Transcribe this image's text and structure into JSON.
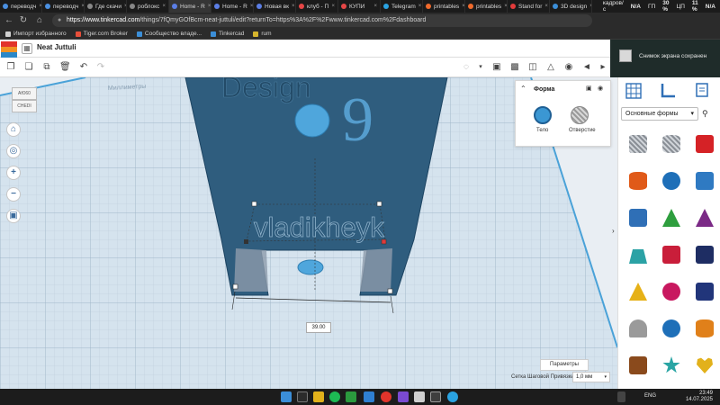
{
  "browser": {
    "tabs": [
      {
        "label": "переводч",
        "color": "#4a8fe0",
        "active": false
      },
      {
        "label": "переводч",
        "color": "#4a8fe0",
        "active": false
      },
      {
        "label": "Где скачи",
        "color": "#888888",
        "active": false
      },
      {
        "label": "роблокс",
        "color": "#888888",
        "active": false
      },
      {
        "label": "Home - R",
        "color": "#5b7ee5",
        "active": true
      },
      {
        "label": "Home - R",
        "color": "#5b7ee5",
        "active": false
      },
      {
        "label": "Новая вк",
        "color": "#5b7ee5",
        "active": false
      },
      {
        "label": "клуб - П",
        "color": "#e64646",
        "active": false
      },
      {
        "label": "КУПИ",
        "color": "#e64646",
        "active": false
      },
      {
        "label": "Telegram",
        "color": "#2aa3e2",
        "active": false
      },
      {
        "label": "printables",
        "color": "#f06a2c",
        "active": false
      },
      {
        "label": "printables",
        "color": "#f06a2c",
        "active": false
      },
      {
        "label": "Stand for",
        "color": "#e33b3b",
        "active": false
      },
      {
        "label": "3D design",
        "color": "#3b8ed8",
        "active": false
      }
    ],
    "url_host": "https://www.tinkercad.com",
    "url_path": "/things/7fQmyGOfBcm-neat-juttuli/edit?returnTo=https%3A%2F%2Fwww.tinkercad.com%2Fdashboard",
    "bookmarks": [
      {
        "label": "Импорт избранного",
        "color": "#d0d0d0"
      },
      {
        "label": "Tiger.com Broker",
        "color": "#e84f3a"
      },
      {
        "label": "Сообщество владе...",
        "color": "#3b8ed8"
      },
      {
        "label": "Tinkercad",
        "color": "#3b8ed8"
      },
      {
        "label": "rum",
        "color": "#d6b52d"
      }
    ]
  },
  "system_tray": {
    "dxd_label": "кадров/с",
    "na1": "N/A",
    "gpu_label": "ГП",
    "gpu_val": "30 %",
    "cpu_label": "ЦП",
    "cpu_val": "11 %",
    "na2": "N/A"
  },
  "notification": {
    "text": "Снимок экрана сохранен"
  },
  "tinkercad": {
    "logo_letters": [
      "TIN",
      "KER",
      "CAD"
    ],
    "project_title": "Neat Juttuli",
    "viewcube": {
      "top": "AЮ60",
      "front": "CHEDI"
    },
    "scene": {
      "design_text": "Design",
      "engraving": "vladikheyk",
      "dimension": "39.00"
    },
    "inspector": {
      "title": "Форма",
      "solid_label": "Тело",
      "hole_label": "Отверстие"
    },
    "shapes_panel": {
      "category": "Основные формы",
      "shapes": [
        {
          "name": "box-hole",
          "color": "#a9b1bb"
        },
        {
          "name": "cylinder-hole",
          "color": "#b1b8c0"
        },
        {
          "name": "box",
          "color": "#d52226"
        },
        {
          "name": "cylinder",
          "color": "#e05a19"
        },
        {
          "name": "sphere",
          "color": "#1e6fb8"
        },
        {
          "name": "scribble",
          "color": "#2f7ac2"
        },
        {
          "name": "text",
          "color": "#2f6fb6"
        },
        {
          "name": "pyramid",
          "color": "#2e9e3e"
        },
        {
          "name": "cone",
          "color": "#7b2a86"
        },
        {
          "name": "roof",
          "color": "#2ba2a5"
        },
        {
          "name": "text-block",
          "color": "#c91e3a"
        },
        {
          "name": "block",
          "color": "#1e2d63"
        },
        {
          "name": "pyramid-yellow",
          "color": "#e6b117"
        },
        {
          "name": "half-sphere",
          "color": "#c8185f"
        },
        {
          "name": "polygon",
          "color": "#21357a"
        },
        {
          "name": "paraboloid",
          "color": "#9a9a9a"
        },
        {
          "name": "torus",
          "color": "#1e6fb8"
        },
        {
          "name": "tube",
          "color": "#e0801a"
        },
        {
          "name": "rock",
          "color": "#8a4a1c"
        },
        {
          "name": "star",
          "color": "#2aa5a4"
        },
        {
          "name": "heart",
          "color": "#e2b11b"
        }
      ]
    },
    "params_label": "Параметры",
    "grid_snap_label": "Сетка Шаговой Привязки",
    "grid_snap_value": "1,0 мм"
  },
  "taskbar": {
    "lang": "ENG",
    "time": "23:49",
    "date": "14.07.2025"
  },
  "colors": {
    "object_face": "#2f5d7e",
    "object_dark": "#1f4a6a",
    "grid_bg": "#dbe6ee",
    "accent_blue": "#3b97d3"
  }
}
